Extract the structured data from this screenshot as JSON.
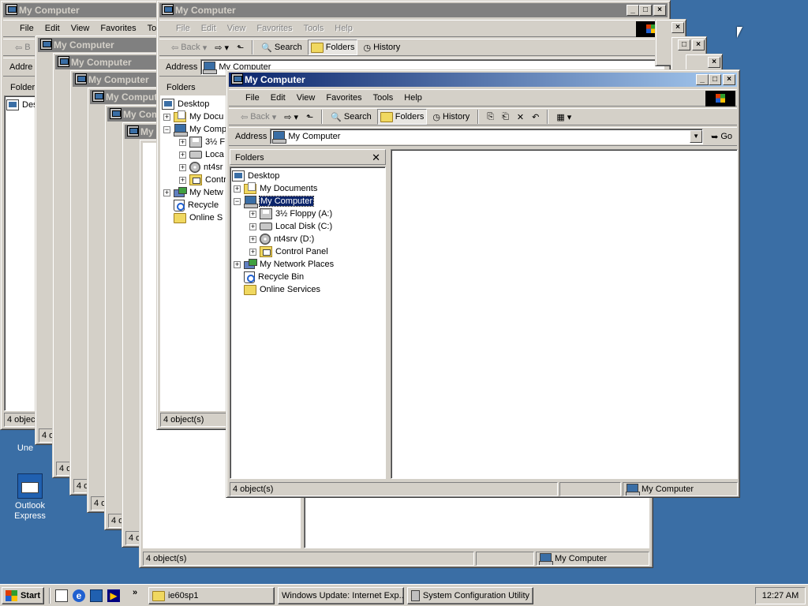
{
  "title": "My Computer",
  "menu": [
    "File",
    "Edit",
    "View",
    "Favorites",
    "Tools",
    "Help"
  ],
  "toolbar": {
    "back": "Back",
    "search": "Search",
    "folders": "Folders",
    "history": "History"
  },
  "address": {
    "label": "Address",
    "value": "My Computer",
    "go": "Go"
  },
  "folders_label": "Folders",
  "tree": {
    "desktop": "Desktop",
    "my_documents": "My Documents",
    "my_computer": "My Computer",
    "floppy": "3½ Floppy (A:)",
    "local_disk": "Local Disk (C:)",
    "nt4srv": "nt4srv (D:)",
    "control_panel": "Control Panel",
    "network": "My Network Places",
    "recycle": "Recycle Bin",
    "online": "Online Services"
  },
  "status": {
    "count": "4 object(s)",
    "location": "My Computer"
  },
  "bg": {
    "desk": "Desk",
    "my_docu": "My Docu",
    "my_comp": "My Comp",
    "floppy3": "3½ F",
    "local": "Loca",
    "nt4sr": "nt4sr",
    "contr": "Contr",
    "my_netw": "My Netw",
    "recycle": "Recycle",
    "online_s": "Online S",
    "addr_short": "Addre",
    "fo": "Fo",
    "four_o": "4 o",
    "four_object": "4 object",
    "four_objec": "4 objec",
    "my_comp_t": "My Comp",
    "fav": "Favorites",
    "to": "To",
    "b": "B"
  },
  "desktop_icons": {
    "outlook": "Outlook Express",
    "une": "Une"
  },
  "taskbar": {
    "start": "Start",
    "task1": "ie60sp1",
    "task2": "Windows Update: Internet Exp...",
    "task3": "System Configuration Utility",
    "clock": "12:27 AM",
    "chevron": "»"
  },
  "colors": {
    "desktop": "#3a6ea5",
    "title_active": "#0a246a",
    "title_inactive": "#808080"
  }
}
